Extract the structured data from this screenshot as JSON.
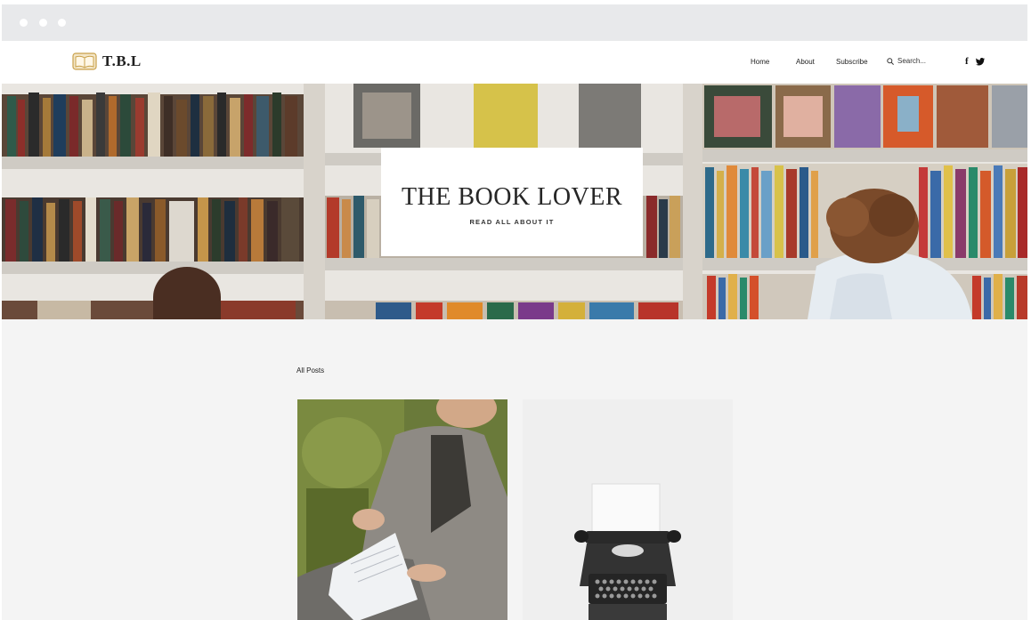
{
  "window": {
    "controls": [
      "dot",
      "dot",
      "dot"
    ]
  },
  "site": {
    "logo_text": "T.B.L",
    "logo_icon": "open-book-icon",
    "brand_color": "#c9a14a"
  },
  "nav": {
    "items": [
      {
        "label": "Home"
      },
      {
        "label": "About"
      },
      {
        "label": "Subscribe"
      }
    ],
    "search_placeholder": "Search...",
    "social": [
      {
        "icon": "facebook-icon",
        "glyph": "f"
      },
      {
        "icon": "twitter-icon",
        "glyph": "•"
      }
    ]
  },
  "hero": {
    "title": "THE BOOK LOVER",
    "subtitle": "READ ALL ABOUT IT"
  },
  "posts": {
    "heading": "All Posts",
    "items": [
      {
        "image": "person-reading-letter-image"
      },
      {
        "image": "typewriter-image"
      }
    ]
  }
}
